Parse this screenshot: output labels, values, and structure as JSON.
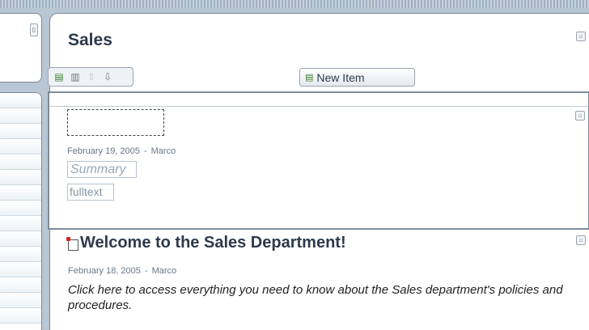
{
  "page": {
    "title": "Sales"
  },
  "toolbar": {
    "icons": [
      "add-icon",
      "delete-icon",
      "move-up-icon",
      "move-down-icon"
    ],
    "new_item_label": "New Item"
  },
  "editing_item": {
    "date": "February 19, 2005",
    "separator": "-",
    "author": "Marco",
    "summary_placeholder": "Summary",
    "fulltext_placeholder": "fulltext"
  },
  "item": {
    "title": "Welcome to the Sales Department!",
    "date": "February 18, 2005",
    "separator": "-",
    "author": "Marco",
    "description": "Click here to access everything you need to know about the Sales department's policies and procedures."
  },
  "colors": {
    "background": "#b9c6d3",
    "title_text": "#2d3a4b",
    "border": "#7d8a98"
  }
}
